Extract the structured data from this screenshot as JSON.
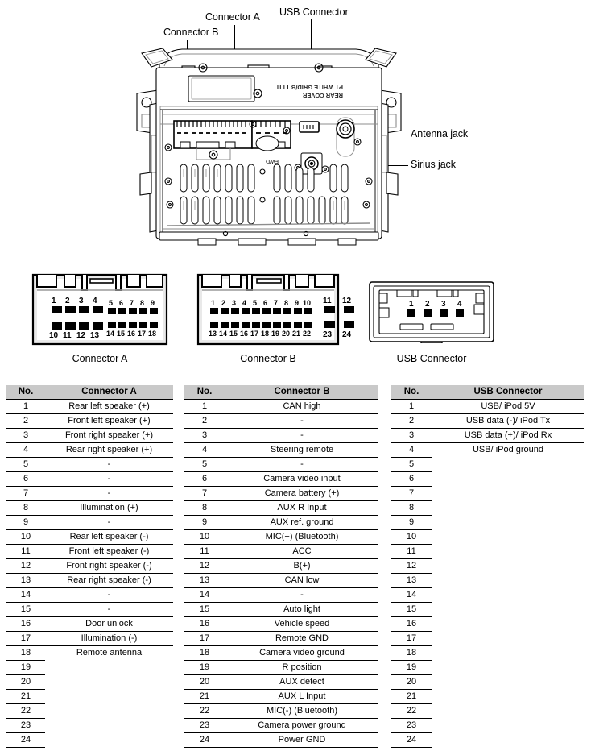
{
  "callouts": [
    {
      "id": "connector-b",
      "label": "Connector B"
    },
    {
      "id": "connector-a",
      "label": "Connector A"
    },
    {
      "id": "usb-connector",
      "label": "USB Connector"
    },
    {
      "id": "antenna-jack",
      "label": "Antenna jack"
    },
    {
      "id": "sirius-jack",
      "label": "Sirius jack"
    }
  ],
  "chassis_markings": {
    "line1": "REAR COVER",
    "line2": "PT WHITE GRID/B TTTI"
  },
  "pinouts": {
    "connector_a": {
      "caption": "Connector A",
      "top_large": [
        "1",
        "2",
        "3",
        "4"
      ],
      "top_small": [
        "5",
        "6",
        "7",
        "8",
        "9"
      ],
      "bottom_large": [
        "10",
        "11",
        "12",
        "13"
      ],
      "bottom_small": [
        "14",
        "15",
        "16",
        "17",
        "18"
      ]
    },
    "connector_b": {
      "caption": "Connector B",
      "top_small": [
        "1",
        "2",
        "3",
        "4",
        "5",
        "6",
        "7",
        "8",
        "9",
        "10"
      ],
      "top_large": [
        "11",
        "12"
      ],
      "bottom_small": [
        "13",
        "14",
        "15",
        "16",
        "17",
        "18",
        "19",
        "20",
        "21",
        "22"
      ],
      "bottom_large": [
        "23",
        "24"
      ]
    },
    "usb_connector": {
      "caption": "USB Connector",
      "pins": [
        "1",
        "2",
        "3",
        "4"
      ]
    }
  },
  "tables": {
    "connector_a": {
      "header_no": "No.",
      "header_name": "Connector A",
      "rows": [
        {
          "no": "1",
          "desc": "Rear left speaker (+)"
        },
        {
          "no": "2",
          "desc": "Front left speaker (+)"
        },
        {
          "no": "3",
          "desc": "Front right speaker (+)"
        },
        {
          "no": "4",
          "desc": "Rear right speaker (+)"
        },
        {
          "no": "5",
          "desc": "-"
        },
        {
          "no": "6",
          "desc": "-"
        },
        {
          "no": "7",
          "desc": "-"
        },
        {
          "no": "8",
          "desc": "Illumination (+)"
        },
        {
          "no": "9",
          "desc": "-"
        },
        {
          "no": "10",
          "desc": "Rear left speaker (-)"
        },
        {
          "no": "11",
          "desc": "Front left speaker (-)"
        },
        {
          "no": "12",
          "desc": "Front right speaker (-)"
        },
        {
          "no": "13",
          "desc": "Rear right speaker (-)"
        },
        {
          "no": "14",
          "desc": "-"
        },
        {
          "no": "15",
          "desc": "-"
        },
        {
          "no": "16",
          "desc": "Door unlock"
        },
        {
          "no": "17",
          "desc": "Illumination (-)"
        },
        {
          "no": "18",
          "desc": "Remote antenna"
        },
        {
          "no": "19",
          "desc": ""
        },
        {
          "no": "20",
          "desc": ""
        },
        {
          "no": "21",
          "desc": ""
        },
        {
          "no": "22",
          "desc": ""
        },
        {
          "no": "23",
          "desc": ""
        },
        {
          "no": "24",
          "desc": ""
        }
      ]
    },
    "connector_b": {
      "header_no": "No.",
      "header_name": "Connector B",
      "rows": [
        {
          "no": "1",
          "desc": "CAN high"
        },
        {
          "no": "2",
          "desc": "-"
        },
        {
          "no": "3",
          "desc": "-"
        },
        {
          "no": "4",
          "desc": "Steering remote"
        },
        {
          "no": "5",
          "desc": "-"
        },
        {
          "no": "6",
          "desc": "Camera video input"
        },
        {
          "no": "7",
          "desc": "Camera battery (+)"
        },
        {
          "no": "8",
          "desc": "AUX R Input"
        },
        {
          "no": "9",
          "desc": "AUX ref. ground"
        },
        {
          "no": "10",
          "desc": "MIC(+) (Bluetooth)"
        },
        {
          "no": "11",
          "desc": "ACC"
        },
        {
          "no": "12",
          "desc": "B(+)"
        },
        {
          "no": "13",
          "desc": "CAN low"
        },
        {
          "no": "14",
          "desc": "-"
        },
        {
          "no": "15",
          "desc": "Auto light"
        },
        {
          "no": "16",
          "desc": "Vehicle speed"
        },
        {
          "no": "17",
          "desc": "Remote GND"
        },
        {
          "no": "18",
          "desc": "Camera video ground"
        },
        {
          "no": "19",
          "desc": "R position"
        },
        {
          "no": "20",
          "desc": "AUX detect"
        },
        {
          "no": "21",
          "desc": "AUX L Input"
        },
        {
          "no": "22",
          "desc": "MIC(-) (Bluetooth)"
        },
        {
          "no": "23",
          "desc": "Camera power ground"
        },
        {
          "no": "24",
          "desc": "Power GND"
        }
      ]
    },
    "usb_connector": {
      "header_no": "No.",
      "header_name": "USB Connector",
      "rows": [
        {
          "no": "1",
          "desc": "USB/ iPod 5V"
        },
        {
          "no": "2",
          "desc": "USB data (-)/ iPod Tx"
        },
        {
          "no": "3",
          "desc": "USB data (+)/ iPod Rx"
        },
        {
          "no": "4",
          "desc": "USB/ iPod ground"
        },
        {
          "no": "5",
          "desc": ""
        },
        {
          "no": "6",
          "desc": ""
        },
        {
          "no": "7",
          "desc": ""
        },
        {
          "no": "8",
          "desc": ""
        },
        {
          "no": "9",
          "desc": ""
        },
        {
          "no": "10",
          "desc": ""
        },
        {
          "no": "11",
          "desc": ""
        },
        {
          "no": "12",
          "desc": ""
        },
        {
          "no": "13",
          "desc": ""
        },
        {
          "no": "14",
          "desc": ""
        },
        {
          "no": "15",
          "desc": ""
        },
        {
          "no": "16",
          "desc": ""
        },
        {
          "no": "17",
          "desc": ""
        },
        {
          "no": "18",
          "desc": ""
        },
        {
          "no": "19",
          "desc": ""
        },
        {
          "no": "20",
          "desc": ""
        },
        {
          "no": "21",
          "desc": ""
        },
        {
          "no": "22",
          "desc": ""
        },
        {
          "no": "23",
          "desc": ""
        },
        {
          "no": "24",
          "desc": ""
        }
      ]
    }
  },
  "colors": {
    "header_bg": "#c9c9c9",
    "line": "#000000",
    "drawing_light": "#8d8d8d",
    "drawing_fill": "#ffffff"
  }
}
